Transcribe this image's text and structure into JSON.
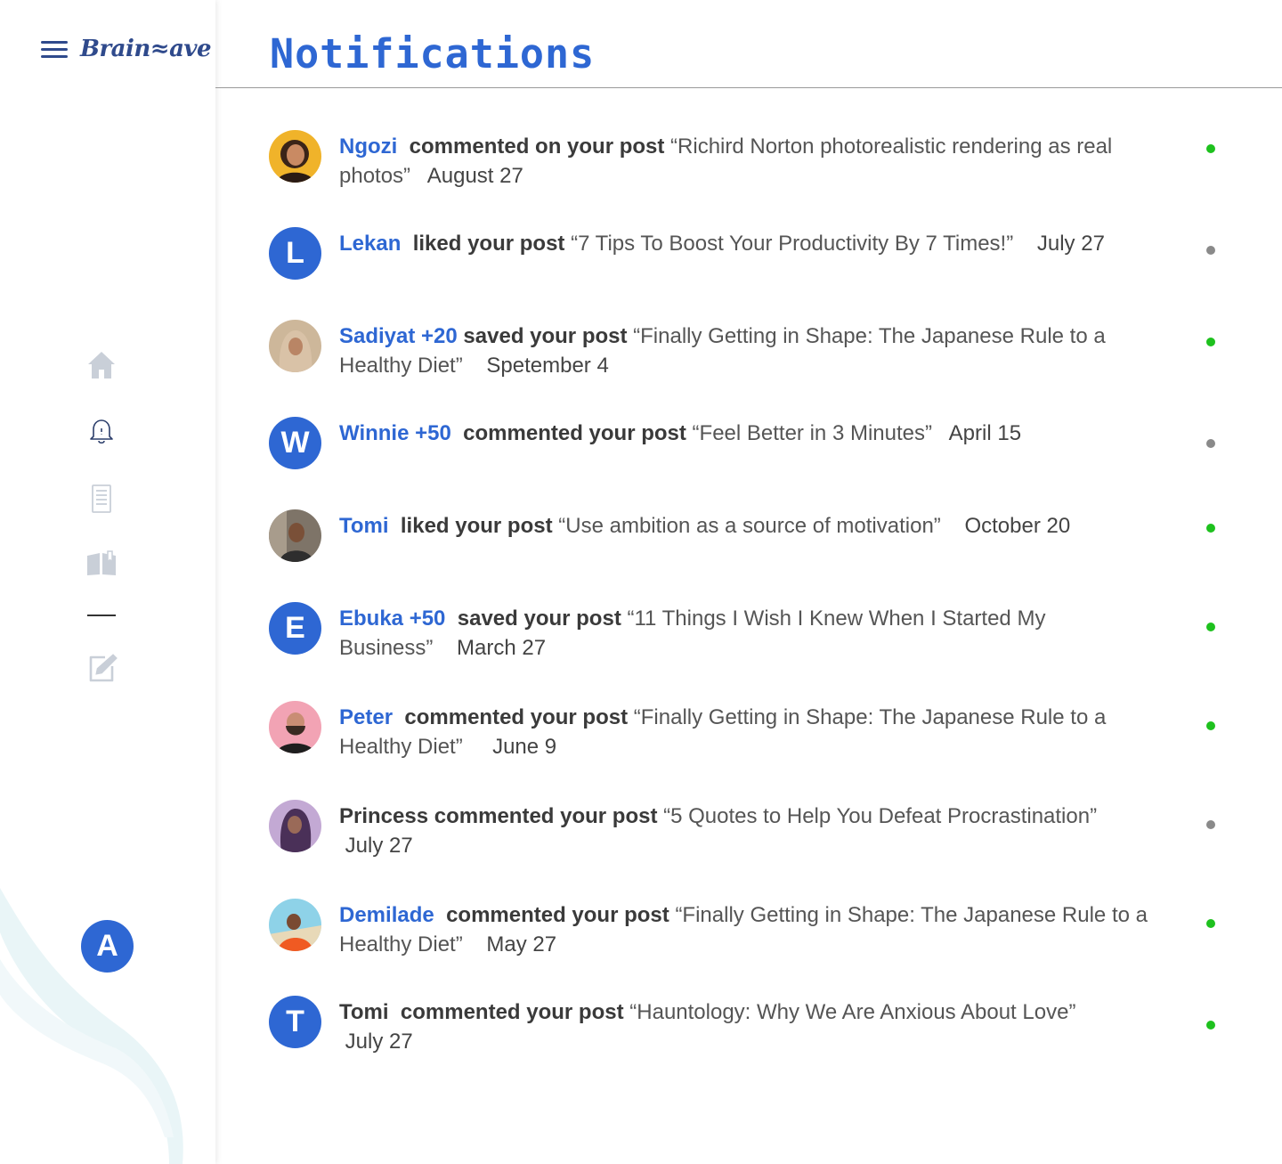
{
  "app": {
    "logo_text": "Brain≈ave"
  },
  "header": {
    "title": "Notifications"
  },
  "sidebar": {
    "items": [
      {
        "icon": "home-icon"
      },
      {
        "icon": "bell-icon"
      },
      {
        "icon": "document-icon"
      },
      {
        "icon": "book-icon"
      },
      {
        "icon": "edit-icon"
      }
    ],
    "user_initial": "A"
  },
  "colors": {
    "accent": "#2e67d3",
    "unread": "#1ec11e",
    "read": "#8a8a8a"
  },
  "notifications": [
    {
      "name": "Ngozi",
      "action": "commented on your post",
      "title": "“Richird Norton photorealistic rendering as real photos”",
      "date": "August 27",
      "avatar": "photo",
      "status": "unread"
    },
    {
      "name": "Lekan",
      "action": "liked your post",
      "title": "“7 Tips To Boost Your Productivity By 7 Times!”",
      "date": "July 27",
      "avatar": "L",
      "status": "read"
    },
    {
      "name": "Sadiyat +20",
      "action": "saved your post",
      "title": "“Finally Getting in Shape: The Japanese Rule to a Healthy Diet”",
      "date": "Spetember 4",
      "avatar": "photo",
      "status": "unread"
    },
    {
      "name": "Winnie +50",
      "action": "commented your post",
      "title": "“Feel Better in 3 Minutes”",
      "date": "April 15",
      "avatar": "W",
      "status": "read"
    },
    {
      "name": "Tomi",
      "action": "liked your post",
      "title": "“Use ambition as a source of motivation”",
      "date": "October 20",
      "avatar": "photo",
      "status": "unread"
    },
    {
      "name": "Ebuka +50",
      "action": "saved your post",
      "title": "“11 Things I Wish I Knew When I Started My Business”",
      "date": "March 27",
      "avatar": "E",
      "status": "unread"
    },
    {
      "name": "Peter",
      "action": "commented your post",
      "title": "“Finally Getting in Shape: The Japanese Rule to a Healthy Diet”",
      "date": "June 9",
      "avatar": "photo",
      "status": "unread"
    },
    {
      "name": "Princess",
      "action": "commented your post",
      "title": "“5 Quotes to Help You Defeat Procrastination”",
      "date": "July 27",
      "avatar": "photo",
      "status": "read"
    },
    {
      "name": "Demilade",
      "action": "commented your post",
      "title": "“Finally Getting in Shape: The Japanese Rule to a Healthy Diet”",
      "date": "May 27",
      "avatar": "photo",
      "status": "unread"
    },
    {
      "name": "Tomi",
      "action": "commented your post",
      "title": "“Hauntology: Why We Are Anxious About Love”",
      "date": "July 27",
      "avatar": "T",
      "status": "unread"
    }
  ]
}
